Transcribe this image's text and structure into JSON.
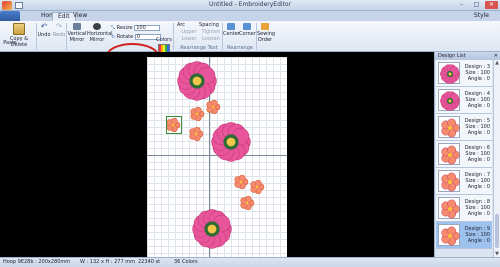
{
  "window": {
    "title": "Untitled - EmbroideryEditor",
    "min": "–",
    "max": "□",
    "close": "✕"
  },
  "tabs": {
    "home": "Home",
    "edit": "Edit",
    "view": "View",
    "style": "Style"
  },
  "ribbon": {
    "copy_delete": "Copy & Delete",
    "paste": "Paste",
    "undo": "Undo",
    "redo": "Redo",
    "vertical": "Vertical",
    "mirror1": "Mirror",
    "horizontal": "Horizontal",
    "mirror2": "Mirror",
    "resize_label": "Resize",
    "resize_value": "100",
    "rotate_label": "Rotate",
    "rotate_value": "0",
    "colors": "Colors",
    "arc": "Arc",
    "spacing": "Spacing",
    "upper": "Upper",
    "lower": "Lower",
    "tighten": "Tighten",
    "loosen": "Loosen",
    "rearrange_text": "Rearrange Text",
    "center": "Center",
    "corner": "Corner",
    "rearrange": "Rearrange",
    "sewing_order": "Sewing Order"
  },
  "panel": {
    "title": "Design List",
    "close": "✕",
    "items": [
      {
        "design": "Design : 3",
        "size": "Size : 100",
        "angle": "Angle : 0",
        "kind": "flower"
      },
      {
        "design": "Design : 4",
        "size": "Size : 100",
        "angle": "Angle : 0",
        "kind": "flower"
      },
      {
        "design": "Design : 5",
        "size": "Size : 100",
        "angle": "Angle : 0",
        "kind": "small"
      },
      {
        "design": "Design : 6",
        "size": "Size : 100",
        "angle": "Angle : 0",
        "kind": "small"
      },
      {
        "design": "Design : 7",
        "size": "Size : 100",
        "angle": "Angle : 0",
        "kind": "small"
      },
      {
        "design": "Design : 8",
        "size": "Size : 100",
        "angle": "Angle : 0",
        "kind": "small"
      },
      {
        "design": "Design : 9",
        "size": "Size : 100",
        "angle": "Angle : 0",
        "kind": "small"
      }
    ],
    "selected_index": 6
  },
  "status": {
    "hoop": "Hoop 9E28b : 200x280mm",
    "dims": "W : 132 x H : 277 mm",
    "stitches": "22340 st",
    "colors": "36 Colors"
  },
  "colors": {
    "big_flower": "#e8559a",
    "big_center": "#f2c84b",
    "small_flower": "#f58a6c",
    "small_center": "#f8c23a",
    "highlight": "#d0201e"
  }
}
